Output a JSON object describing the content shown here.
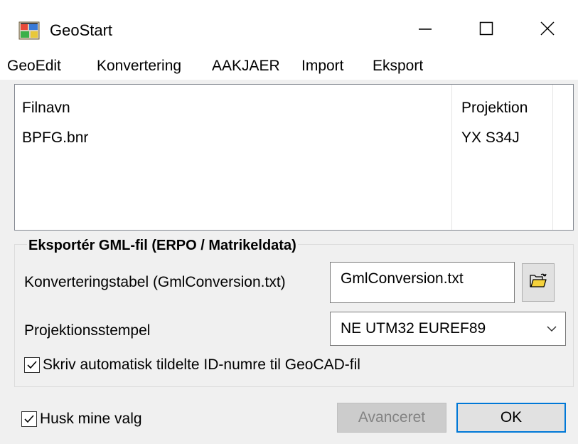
{
  "window": {
    "title": "GeoStart",
    "app_icon": "geostart-app-icon",
    "controls": {
      "minimize": "minimize-icon",
      "maximize": "maximize-icon",
      "close": "close-icon"
    }
  },
  "menu": {
    "items": [
      {
        "label": "GeoEdit"
      },
      {
        "label": "Konvertering"
      },
      {
        "label": "AAKJAER"
      },
      {
        "label": "Import"
      },
      {
        "label": "Eksport"
      }
    ]
  },
  "file_list": {
    "columns": [
      "Filnavn",
      "Projektion"
    ],
    "rows": [
      {
        "filename": "BPFG.bnr",
        "projection": "YX S34J"
      }
    ]
  },
  "export_group": {
    "title": "Eksportér GML-fil (ERPO / Matrikeldata)",
    "conversion_table_label": "Konverteringstabel (GmlConversion.txt)",
    "conversion_table_value": "GmlConversion.txt",
    "browse_icon": "open-folder-icon",
    "projection_stamp_label": "Projektionsstempel",
    "projection_stamp_value": "NE UTM32 EUREF89",
    "write_ids_label": "Skriv automatisk tildelte ID-numre til GeoCAD-fil",
    "write_ids_checked": true
  },
  "footer": {
    "remember_label": "Husk mine valg",
    "remember_checked": true,
    "advanced_label": "Avanceret",
    "ok_label": "OK"
  },
  "colors": {
    "window_bg": "#f0f0f0",
    "ok_border": "#0078d7",
    "disabled_text": "#838383"
  }
}
